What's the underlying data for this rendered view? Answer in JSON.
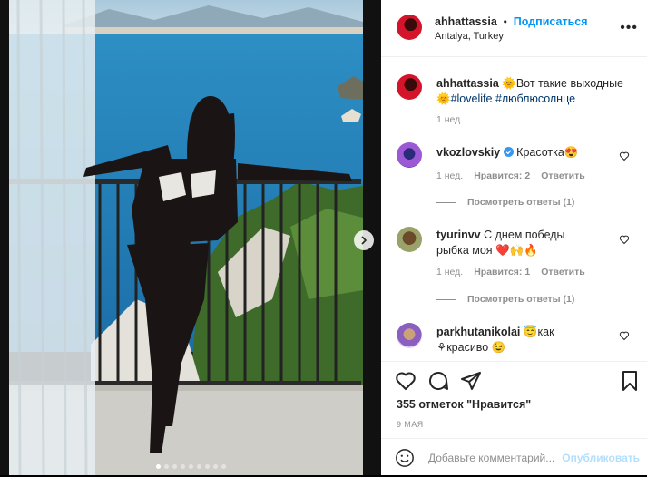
{
  "post": {
    "username": "ahhattassia",
    "follow_label": "Подписаться",
    "separator": "•",
    "location": "Antalya, Turkey",
    "more_icon": "more-horizontal-icon",
    "caption": {
      "username": "ahhattassia",
      "emoji1": "🌞",
      "text": "Вот такие выходные",
      "emoji2": "🌞",
      "tag1": "#lovelife",
      "tag2": "#люблюсолнце",
      "time": "1 нед."
    },
    "carousel": {
      "slides": 9,
      "active_index": 0
    }
  },
  "comments": [
    {
      "username": "vkozlovskiy",
      "verified": true,
      "text": "Красотка😍",
      "time": "1 нед.",
      "likes": "Нравится: 2",
      "reply": "Ответить",
      "view_replies": "Посмотреть ответы (1)"
    },
    {
      "username": "tyurinvv",
      "text": "С днем победы рыбка моя ❤️🙌🔥",
      "time": "1 нед.",
      "likes": "Нравится: 1",
      "reply": "Ответить",
      "view_replies": "Посмотреть ответы (1)"
    },
    {
      "username": "parkhutanikolai",
      "text": "😇как ⚘красиво 😉"
    }
  ],
  "footer": {
    "likes_text": "355 отметок \"Нравится\"",
    "date": "9 МАЯ",
    "comment_placeholder": "Добавьте комментарий...",
    "publish_label": "Опубликовать"
  },
  "colors": {
    "link": "#0095f6",
    "hashtag": "#00376b",
    "muted": "#8e8e8e",
    "like_red": "#ed4956"
  }
}
